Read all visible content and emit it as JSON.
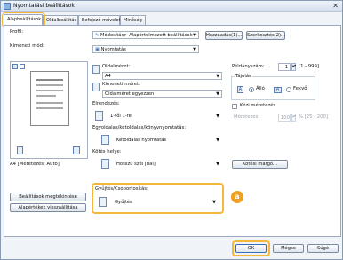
{
  "window": {
    "title": "Nyomtatási beállítások"
  },
  "tabs": [
    "Alapbeállítások",
    "Oldalbeállítás",
    "Befejező művelet",
    "Minőség"
  ],
  "profile": {
    "label": "Profil:",
    "value": "Módosítás> Alapértelmezett beállítások",
    "add_button": "Hozzáadás(1)...",
    "edit_button": "Szerkesztés(2)..."
  },
  "output": {
    "label": "Kimeneti mód:",
    "value": "Nyomtatás"
  },
  "preview": {
    "caption": "A4 [Méretezés: Auto]"
  },
  "page_size": {
    "label": "Oldalméret:",
    "value": "A4"
  },
  "output_size": {
    "label": "Kimeneti méret:",
    "value": "Oldalméret egyezzen"
  },
  "layout": {
    "label": "Elrendezés:",
    "value": "1-től 1-re"
  },
  "duplex": {
    "label": "Egyoldalas/kétoldalas/könyvnyomtatás:",
    "value": "Kétoldalas nyomtatás"
  },
  "binding": {
    "label": "Kötés helye:",
    "value": "Hosszú szél [bal]",
    "margin_button": "Kötési margó..."
  },
  "finishing": {
    "label": "Gyűjtés/Csoportosítás:",
    "value": "Gyűjtés",
    "badge": "a"
  },
  "copies": {
    "label": "Példányszám:",
    "value": "1",
    "range": "[1 - 999]"
  },
  "orientation": {
    "label": "Tájolás",
    "portrait": "Álló",
    "landscape": "Fekvő"
  },
  "manual_scaling": {
    "label": "Kézi méretezés",
    "sub_label": "Méretezés:",
    "value": "100",
    "range": "% [25 - 200]"
  },
  "left_buttons": {
    "view_settings": "Beállítások megtekintése",
    "restore_defaults": "Alapértékek visszaállítása"
  },
  "footer": {
    "ok": "OK",
    "cancel": "Mégse",
    "help": "Súgó"
  },
  "colors": {
    "highlight": "#f3b73a",
    "badge": "#f0a020"
  }
}
